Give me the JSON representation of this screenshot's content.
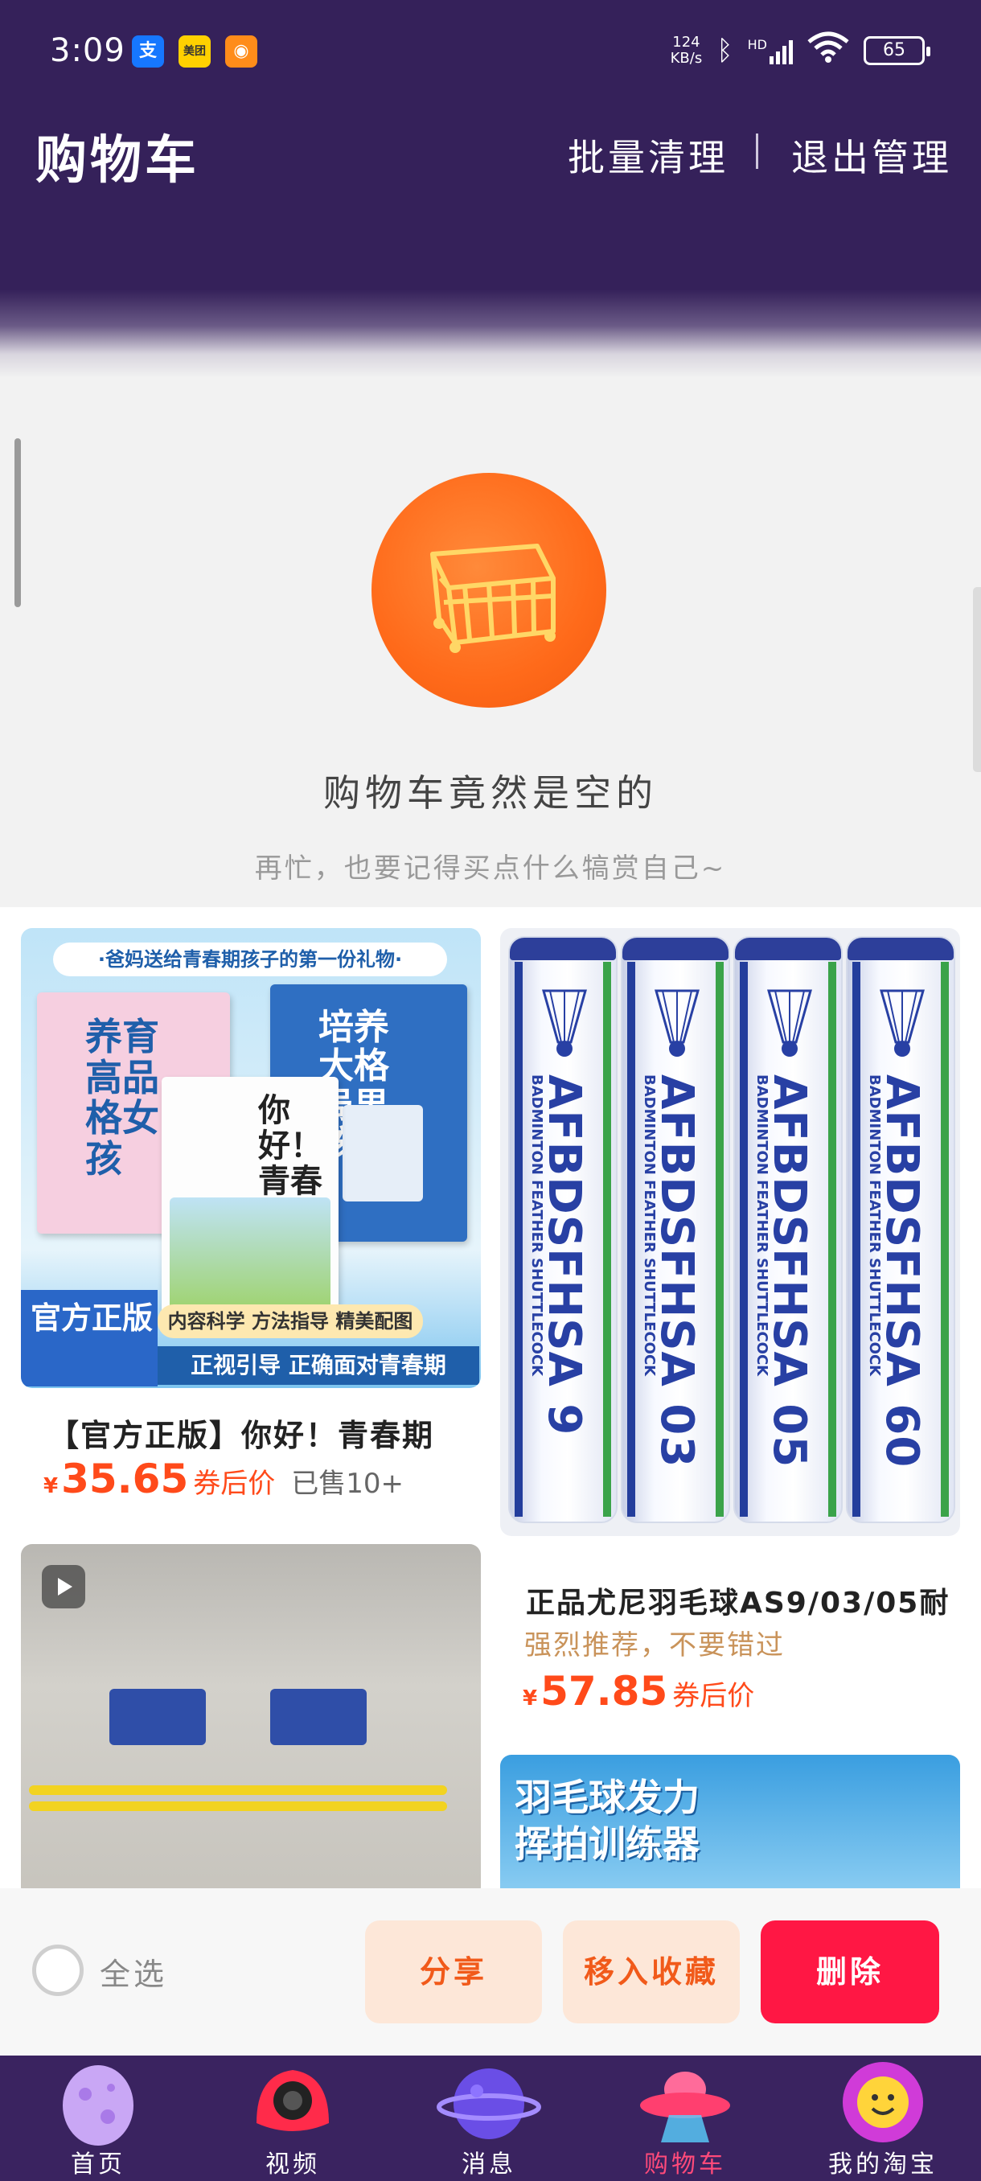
{
  "status_bar": {
    "time": "3:09",
    "notif_icons": [
      "支",
      "美团",
      "◉"
    ],
    "net_speed_top": "124",
    "net_speed_bottom": "KB/s",
    "network": "HD",
    "battery": "65"
  },
  "header": {
    "title": "购物车",
    "batch_clean": "批量清理",
    "exit_manage": "退出管理"
  },
  "empty_state": {
    "title": "购物车竟然是空的",
    "subtitle": "再忙，也要记得买点什么犒赏自己~",
    "icon": "empty-cart-icon"
  },
  "products": [
    {
      "title": "【官方正版】你好！青春期",
      "yen": "¥",
      "price": "35.65",
      "coupon_label": "券后价",
      "sold": "已售10+",
      "image": {
        "banner": "·爸妈送给青春期孩子的第一份礼物·",
        "book1": "养育高品格女孩",
        "book2": "培养大格局男孩",
        "book3": "你好！青春期",
        "official": "官方正版",
        "feature_pill": "内容科学 方法指导 精美配图",
        "feature_bar": "正视引导 正确面对青春期"
      }
    },
    {
      "title": "正品尤尼羽毛球AS9/03/05耐",
      "recommend": "强烈推荐，不要错过",
      "yen": "¥",
      "price": "57.85",
      "coupon_label": "券后价",
      "image": {
        "tubes": [
          {
            "main": "AFBDSFHSA 9",
            "sub": "BADMINTON FEATHER SHUTTLECOCK"
          },
          {
            "main": "AFBDSFHSA 03",
            "sub": "BADMINTON FEATHER SHUTTLECOCK"
          },
          {
            "main": "AFBDSFHSA 05",
            "sub": "BADMINTON FEATHER SHUTTLECOCK"
          },
          {
            "main": "AFBDSFHSA 60",
            "sub": "BADMINTON FEATHER SHUTTLECOCK"
          }
        ]
      }
    },
    {
      "image": {
        "type": "video",
        "icon": "play-icon"
      }
    },
    {
      "image": {
        "text_line1": "羽毛球发力",
        "text_line2": "挥拍训练器"
      }
    }
  ],
  "action_bar": {
    "select_all": "全选",
    "share": "分享",
    "move_to_favorites": "移入收藏",
    "delete": "删除"
  },
  "tabs": [
    {
      "label": "首页",
      "icon": "egg-icon",
      "active": false
    },
    {
      "label": "视频",
      "icon": "camera-icon",
      "active": false
    },
    {
      "label": "消息",
      "icon": "planet-icon",
      "active": false
    },
    {
      "label": "购物车",
      "icon": "ufo-icon",
      "active": true
    },
    {
      "label": "我的淘宝",
      "icon": "smiley-icon",
      "active": false
    }
  ],
  "colors": {
    "header_bg": "#35215a",
    "accent_price": "#ff4a1a",
    "delete_btn": "#ff1744",
    "tab_active": "#ff4a7a"
  }
}
